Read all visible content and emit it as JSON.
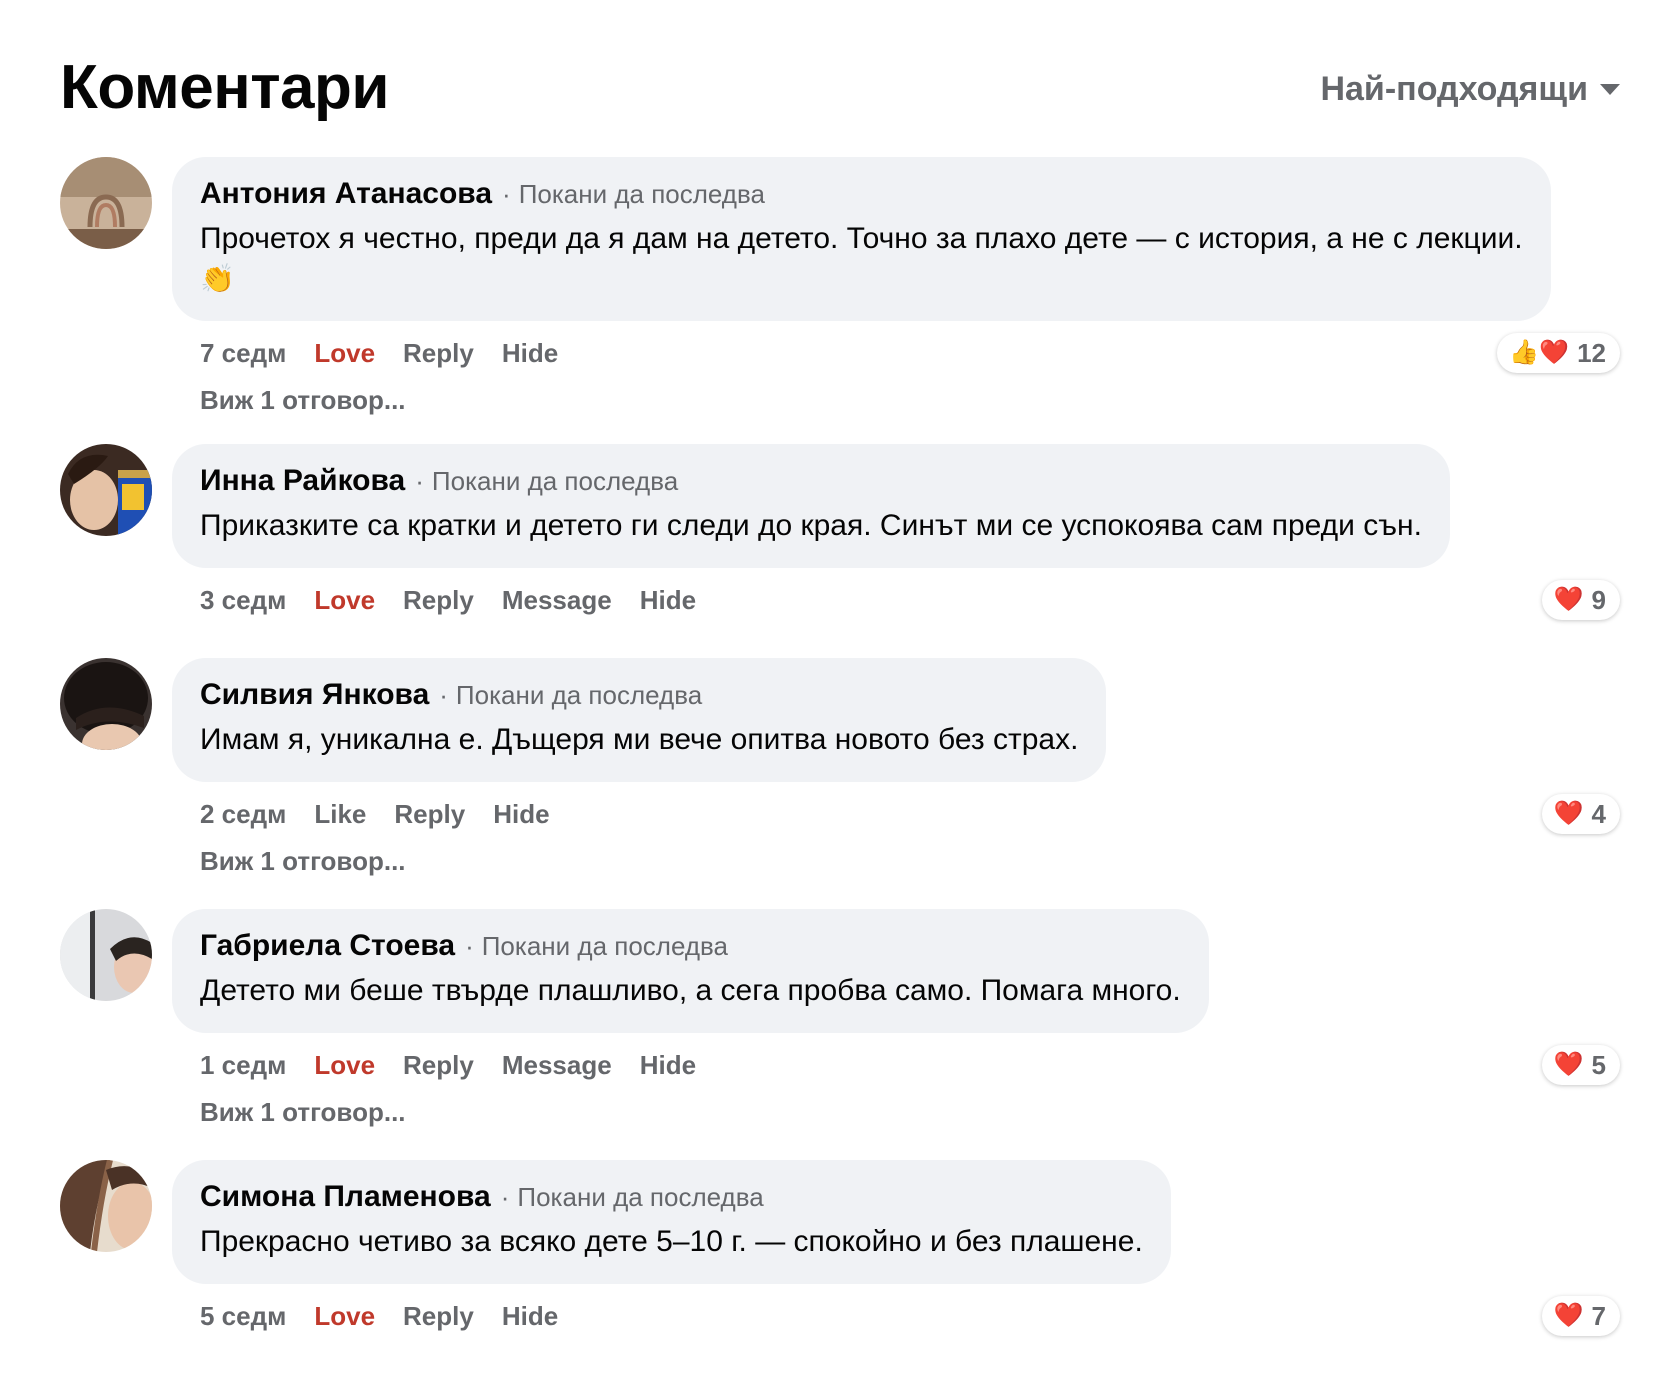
{
  "header": {
    "title": "Коментари",
    "sort_label": "Най-подходящи"
  },
  "comments": [
    {
      "author": "Антония Атанасова",
      "invite": "Покани да последва",
      "text": "Прочетох я честно, преди да я дам на детето. Точно за плахо дете — с история, а не с лекции.",
      "emoji": "👏",
      "time": "7 седм",
      "love": "Love",
      "reply": "Reply",
      "hide": "Hide",
      "reaction_icons": "👍❤️",
      "reaction_count": "12",
      "replies_link": "Виж 1 отговор..."
    },
    {
      "author": "Инна Райкова",
      "invite": "Покани да последва",
      "text": "Приказките са кратки и детето ги следи до края. Синът ми се успокоява сам преди сън.",
      "time": "3 седм",
      "love": "Love",
      "reply": "Reply",
      "message": "Message",
      "hide": "Hide",
      "reaction_icons": "❤️",
      "reaction_count": "9"
    },
    {
      "author": "Силвия Янкова",
      "invite": "Покани да последва",
      "text": "Имам я, уникална е. Дъщеря ми вече опитва новото без страх.",
      "time": "2 седм",
      "like": "Like",
      "reply": "Reply",
      "hide": "Hide",
      "reaction_icons": "❤️",
      "reaction_count": "4",
      "replies_link": "Виж 1 отговор..."
    },
    {
      "author": "Габриела Стоева",
      "invite": "Покани да последва",
      "text": "Детето ми беше твърде плашливо, а сега пробва само. Помага много.",
      "time": "1 седм",
      "love": "Love",
      "reply": "Reply",
      "message": "Message",
      "hide": "Hide",
      "reaction_icons": "❤️",
      "reaction_count": "5",
      "replies_link": "Виж 1 отговор..."
    },
    {
      "author": "Симона Пламенова",
      "invite": "Покани да последва",
      "text": "Прекрасно четиво за всяко дете 5–10 г. — спокойно и без плашене.",
      "time": "5 седм",
      "love": "Love",
      "reply": "Reply",
      "hide": "Hide",
      "reaction_icons": "❤️",
      "reaction_count": "7"
    }
  ],
  "colors": {
    "bubble": "#f0f2f5",
    "secondary_text": "#65676b",
    "love_active": "#c0392b"
  }
}
